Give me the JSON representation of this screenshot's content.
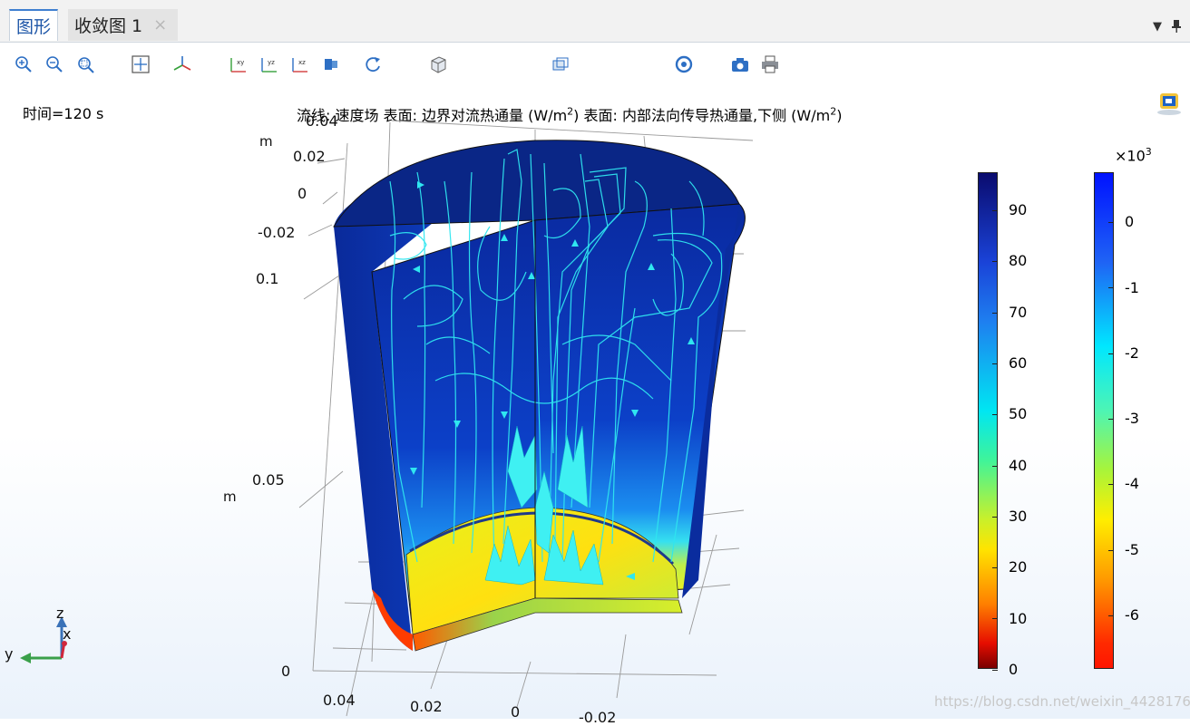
{
  "tabs": [
    {
      "label": "图形",
      "active": true
    },
    {
      "label": "收敛图 1",
      "active": false,
      "close": "×"
    }
  ],
  "window_controls": {
    "menu": "▼",
    "pin": "📌"
  },
  "toolbar": {
    "icons": [
      "zoom-in-icon",
      "zoom-out-icon",
      "zoom-box-icon",
      "zoom-extents-icon",
      "axis-orientation-icon",
      "view-xy-icon",
      "view-yz-icon",
      "view-xz-icon",
      "scene-light-icon",
      "rotate-icon",
      "view-cube-icon",
      "speaker-icon",
      "wireframe-icon",
      "show-grid-icon",
      "show-axis-icon",
      "show-legend-icon",
      "shutter-icon",
      "camera-icon",
      "print-icon"
    ]
  },
  "plot": {
    "time_label": "时间=120 s",
    "title_parts": {
      "a": "流线: 速度场  表面: 边界对流热通量 (W/m",
      "b": ")  表面: 内部法向传导热通量,下侧 (W/m",
      "c": ")",
      "sup": "2"
    },
    "axis_labels": {
      "z_unit_top": "m",
      "z_ticks_top": [
        "0.04",
        "0.02",
        "0",
        "-0.02"
      ],
      "z_unit_mid": "m",
      "z_ticks_left": [
        "0.1",
        "0.05",
        "0"
      ],
      "x_ticks_bottom": [
        "0.04",
        "0.02",
        "0",
        "-0.02"
      ]
    },
    "triad": {
      "z": "z",
      "y": "y",
      "x": "x"
    }
  },
  "colorbar1": {
    "ticks": [
      "90",
      "80",
      "70",
      "60",
      "50",
      "40",
      "30",
      "20",
      "10",
      "0"
    ]
  },
  "colorbar2": {
    "multiplier": "×10",
    "multiplier_sup": "3",
    "ticks": [
      "0",
      "-1",
      "-2",
      "-3",
      "-4",
      "-5",
      "-6"
    ]
  },
  "watermark": "https://blog.csdn.net/weixin_44281768",
  "colors": {
    "accent": "#3f7fd0",
    "tab_text": "#1f57a8",
    "streamline": "#27e6ee",
    "cylinder_blue": "#0b2aa8"
  }
}
